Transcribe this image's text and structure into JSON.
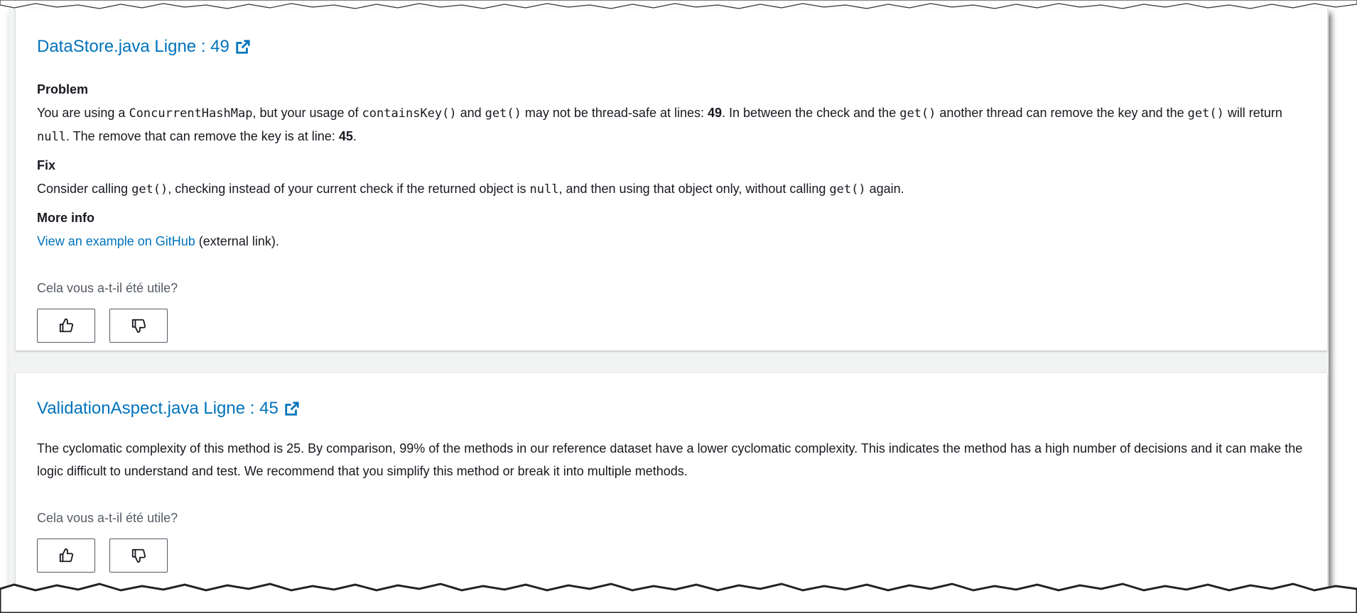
{
  "findings": [
    {
      "title": "DataStore.java Ligne : 49",
      "problem_label": "Problem",
      "problem": {
        "t1": "You are using a ",
        "c1": "ConcurrentHashMap",
        "t2": ", but your usage of ",
        "c2": "containsKey()",
        "t3": " and ",
        "c3": "get()",
        "t4": " may not be thread-safe at lines: ",
        "b1": "49",
        "t5": ". In between the check and the ",
        "c4": "get()",
        "t6": " another thread can remove the key and the ",
        "c5": "get()",
        "t7": " will return ",
        "c6": "null",
        "t8": ". The remove that can remove the key is at line: ",
        "b2": "45",
        "t9": "."
      },
      "fix_label": "Fix",
      "fix": {
        "t1": "Consider calling ",
        "c1": "get()",
        "t2": ", checking instead of your current check if the returned object is ",
        "c2": "null",
        "t3": ", and then using that object only, without calling ",
        "c3": "get()",
        "t4": " again."
      },
      "more_info_label": "More info",
      "more_info_link": "View an example on GitHub",
      "more_info_suffix": " (external link).",
      "question": "Cela vous a-t-il été utile?"
    },
    {
      "title": "ValidationAspect.java Ligne : 45",
      "description": "The cyclomatic complexity of this method is 25. By comparison, 99% of the methods in our reference dataset have a lower cyclomatic complexity. This indicates the method has a high number of decisions and it can make the logic difficult to understand and test. We recommend that you simplify this method or break it into multiple methods.",
      "question": "Cela vous a-t-il été utile?"
    }
  ],
  "icons": {
    "external": "external-link-icon",
    "thumbs_up": "thumbs-up-icon",
    "thumbs_down": "thumbs-down-icon"
  },
  "colors": {
    "link": "#0073bb",
    "text": "#16191f",
    "muted": "#545b64",
    "background": "#f2f3f3"
  }
}
